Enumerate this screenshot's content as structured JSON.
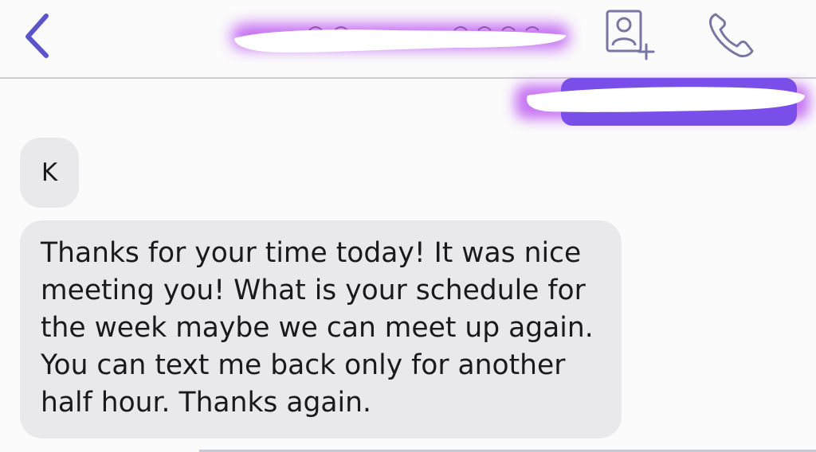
{
  "header": {
    "back_icon": "chevron-left-icon",
    "contact_name_redacted": true,
    "add_contact_icon": "add-contact-icon",
    "call_icon": "phone-icon"
  },
  "banner": {
    "redacted": true
  },
  "messages": [
    {
      "direction": "received",
      "text": "K"
    },
    {
      "direction": "received",
      "lines": [
        "Thanks for your time today! It was nice",
        "meeting you! What is your schedule for",
        "the week maybe we can meet up again.",
        "You can text me back only for another",
        "half hour. Thanks again."
      ]
    }
  ],
  "colors": {
    "accent": "#5b55c9",
    "icon_gray": "#7a76a3",
    "received_bubble": "#e9e9eb",
    "redaction_glow": "#b23cf0"
  }
}
